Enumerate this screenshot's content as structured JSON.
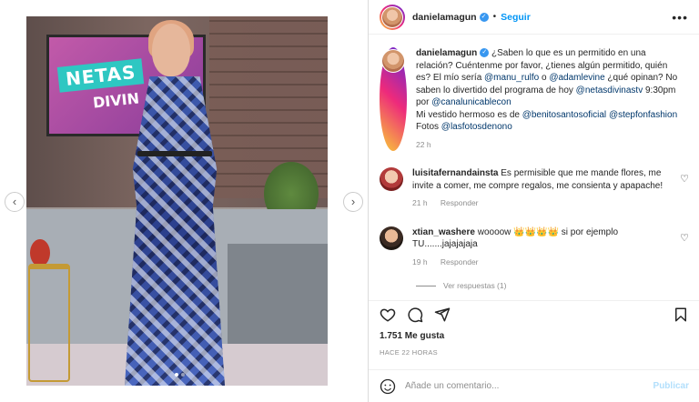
{
  "post": {
    "username": "danielamagun",
    "follow_label": "Seguir",
    "separator": "•",
    "more_icon": "more-horizontal-icon"
  },
  "caption": {
    "username": "danielamagun",
    "text_1": "¿Saben lo que es un permitido en una relación? Cuéntenme por favor, ¿tienes algún permitido, quién es? El mío sería ",
    "tag_1": "@manu_rulfo",
    "text_2": " o ",
    "tag_2": "@adamlevine",
    "text_3": " ¿qué opinan? No saben lo divertido del programa de hoy ",
    "tag_3": "@netasdivinastv",
    "text_4": " 9:30pm por ",
    "tag_4": "@canalunicablecon",
    "text_5": "Mi vestido hermoso es de ",
    "tag_5": "@benitosantosoficial",
    "tag_6": "@stepfonfashion",
    "text_6": "Fotos ",
    "tag_7": "@lasfotosdenono",
    "time": "22 h"
  },
  "comments": [
    {
      "username": "luisitafernandainsta",
      "text": "Es permisible que me mande flores, me invite a comer, me compre regalos, me consienta y apapache!",
      "time": "21 h",
      "reply_label": "Responder"
    },
    {
      "username": "xtian_washere",
      "text": "woooow 👑👑👑👑 si por ejemplo TU.......jajajajaja",
      "time": "19 h",
      "reply_label": "Responder",
      "view_replies": "Ver respuestas (1)"
    }
  ],
  "media": {
    "screen_title": "NETAS",
    "screen_sub": "DIVIN",
    "prev_icon": "chevron-left-icon",
    "next_icon": "chevron-right-icon"
  },
  "stats": {
    "likes": "1.751 Me gusta",
    "timestamp": "HACE 22 HORAS"
  },
  "add_comment": {
    "placeholder": "Añade un comentario...",
    "publish_label": "Publicar"
  },
  "colors": {
    "link": "#0095f6",
    "tag": "#00376b",
    "muted": "#8e8e8e",
    "text": "#262626"
  }
}
